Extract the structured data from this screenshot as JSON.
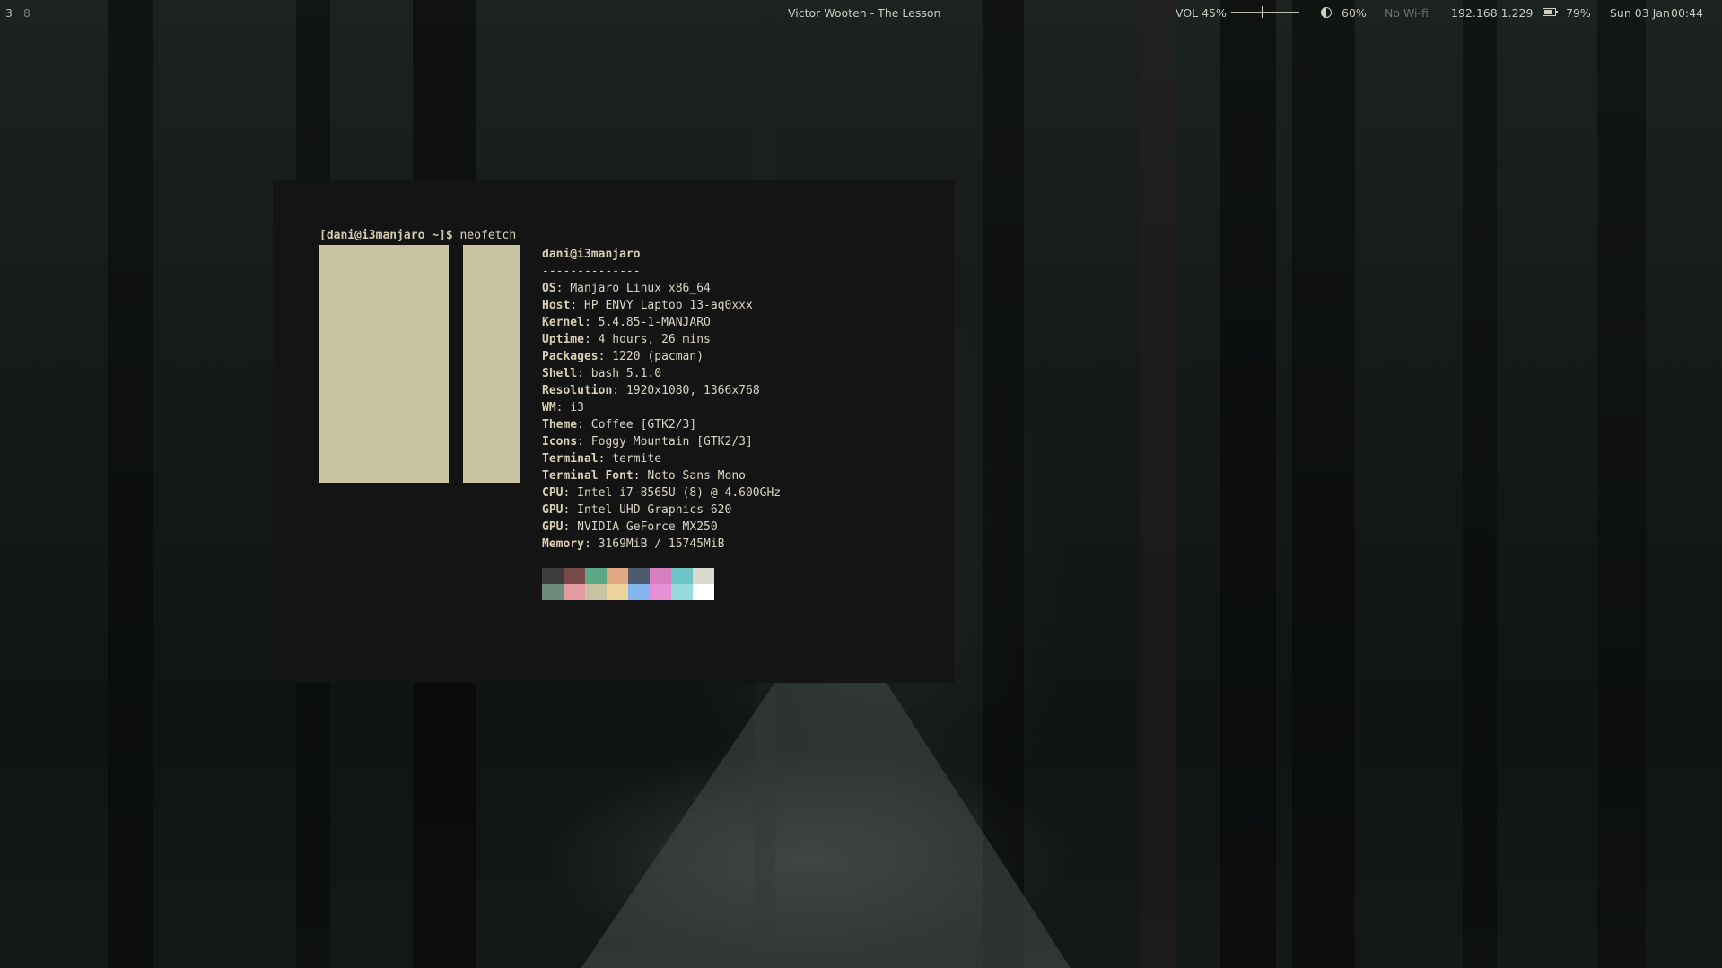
{
  "statusbar": {
    "workspaces": [
      "3",
      "8"
    ],
    "now_playing": "Victor Wooten - The Lesson",
    "volume": "VOL 45%",
    "volume_level": 0.45,
    "brightness": "60%",
    "wifi": "No Wi-fi",
    "ip": "192.168.1.229",
    "battery": "79%",
    "date": "Sun 03 Jan",
    "time": "00:44"
  },
  "terminal": {
    "prompt": "[dani@i3manjaro ~]$",
    "command": "neofetch",
    "userhost": "dani@i3manjaro",
    "separator": "--------------",
    "info": [
      {
        "key": "OS",
        "value": "Manjaro Linux x86_64"
      },
      {
        "key": "Host",
        "value": "HP ENVY Laptop 13-aq0xxx"
      },
      {
        "key": "Kernel",
        "value": "5.4.85-1-MANJARO"
      },
      {
        "key": "Uptime",
        "value": "4 hours, 26 mins"
      },
      {
        "key": "Packages",
        "value": "1220 (pacman)"
      },
      {
        "key": "Shell",
        "value": "bash 5.1.0"
      },
      {
        "key": "Resolution",
        "value": "1920x1080, 1366x768"
      },
      {
        "key": "WM",
        "value": "i3"
      },
      {
        "key": "Theme",
        "value": "Coffee [GTK2/3]"
      },
      {
        "key": "Icons",
        "value": "Foggy Mountain [GTK2/3]"
      },
      {
        "key": "Terminal",
        "value": "termite"
      },
      {
        "key": "Terminal Font",
        "value": "Noto Sans Mono"
      },
      {
        "key": "CPU",
        "value": "Intel i7-8565U (8) @ 4.600GHz"
      },
      {
        "key": "GPU",
        "value": "Intel UHD Graphics 620"
      },
      {
        "key": "GPU",
        "value": "NVIDIA GeForce MX250"
      },
      {
        "key": "Memory",
        "value": "3169MiB / 15745MiB"
      }
    ],
    "logo_color": "#c8c3a0",
    "palette_top": [
      "#3c3c3c",
      "#7a4a4a",
      "#5aa886",
      "#e0a883",
      "#4c5a6c",
      "#d77ec0",
      "#6dc4c4",
      "#d8d8cc"
    ],
    "palette_bottom": [
      "#6e8c7c",
      "#e39ca0",
      "#c9c3a2",
      "#f0d59a",
      "#84b6f0",
      "#e68fd6",
      "#96dcdc",
      "#ffffff"
    ]
  }
}
